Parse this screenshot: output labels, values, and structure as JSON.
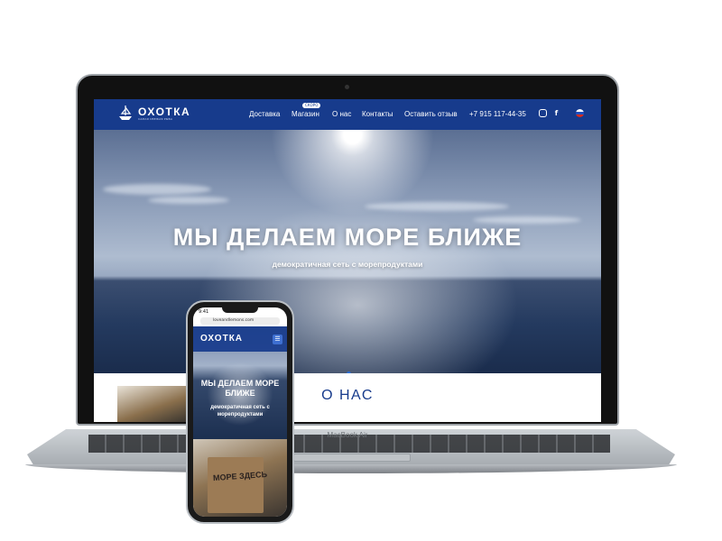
{
  "laptop": {
    "model_label": "MacBook Air"
  },
  "site": {
    "logo": "ОХОТКА",
    "logo_tagline": "САМАЯ СВЕЖАЯ РЫБА",
    "nav": [
      {
        "label": "Доставка"
      },
      {
        "label": "Магазин",
        "badge": "СКОРО"
      },
      {
        "label": "О нас"
      },
      {
        "label": "Контакты"
      },
      {
        "label": "Оставить отзыв"
      }
    ],
    "phone": "+7 915 117-44-35",
    "icons": [
      "instagram-icon",
      "facebook-icon",
      "language-flag-icon"
    ],
    "brand_color": "#173b8c",
    "hero": {
      "title": "МЫ ДЕЛАЕМ МОРЕ БЛИЖЕ",
      "subtitle": "демократичная сеть с морепродуктами",
      "slide_index": 1,
      "slide_count": 3
    },
    "about_title": "О НАС"
  },
  "mobile": {
    "time": "9:41",
    "url": "loveandlemons.com",
    "logo": "ОХОТКА",
    "hero_title": "МЫ ДЕЛАЕМ МОРЕ БЛИЖЕ",
    "hero_subtitle": "демократичная сеть с морепродуктами",
    "bag_text": "МОРЕ ЗДЕСЬ"
  }
}
